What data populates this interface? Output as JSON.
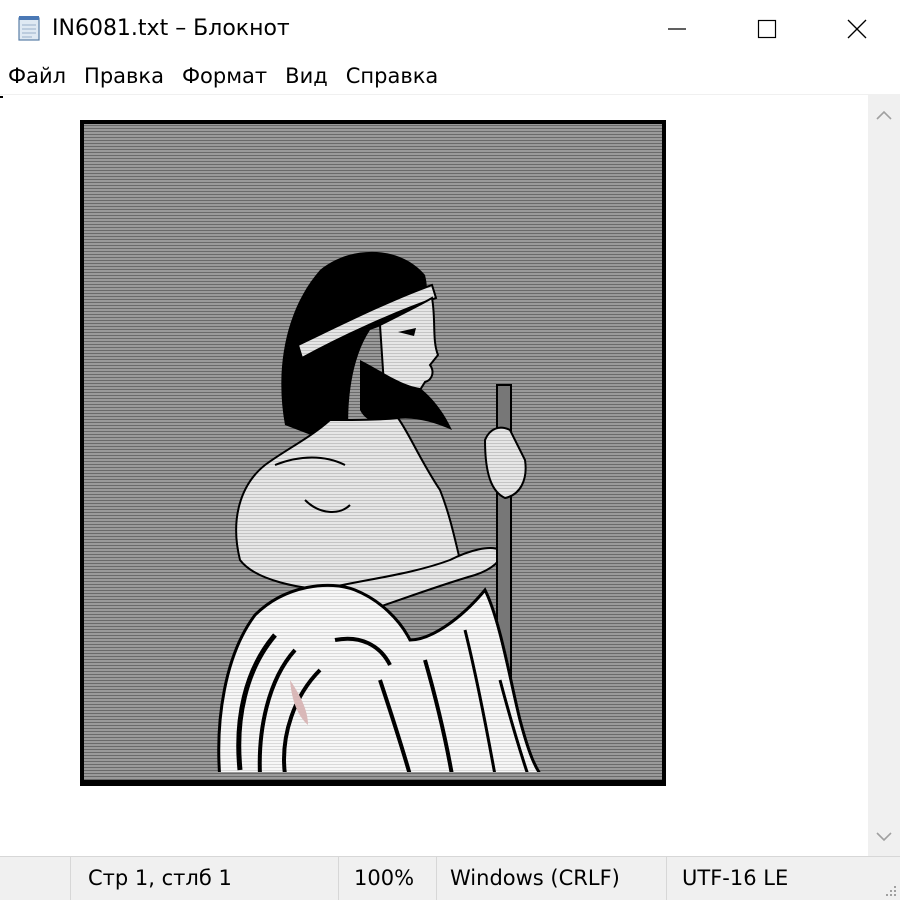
{
  "window": {
    "title": "IN6081.txt – Блокнот",
    "app_icon": "notepad-icon"
  },
  "caption_buttons": {
    "minimize_icon": "minimize-icon",
    "maximize_icon": "maximize-icon",
    "close_icon": "close-icon"
  },
  "menu": {
    "items": [
      {
        "label": "Файл"
      },
      {
        "label": "Правка"
      },
      {
        "label": "Формат"
      },
      {
        "label": "Вид"
      },
      {
        "label": "Справка"
      }
    ]
  },
  "document": {
    "content_icon": "ascii-art-greek-figure-image"
  },
  "scrollbar": {
    "up_icon": "chevron-up-icon",
    "down_icon": "chevron-down-icon"
  },
  "status": {
    "position": "Стр 1, стлб 1",
    "zoom": "100%",
    "line_endings": "Windows (CRLF)",
    "encoding": "UTF-16 LE"
  },
  "colors": {
    "background": "#ffffff",
    "chrome": "#f0f0f0",
    "art_gray": "#8c8c8c",
    "ink": "#000000"
  }
}
